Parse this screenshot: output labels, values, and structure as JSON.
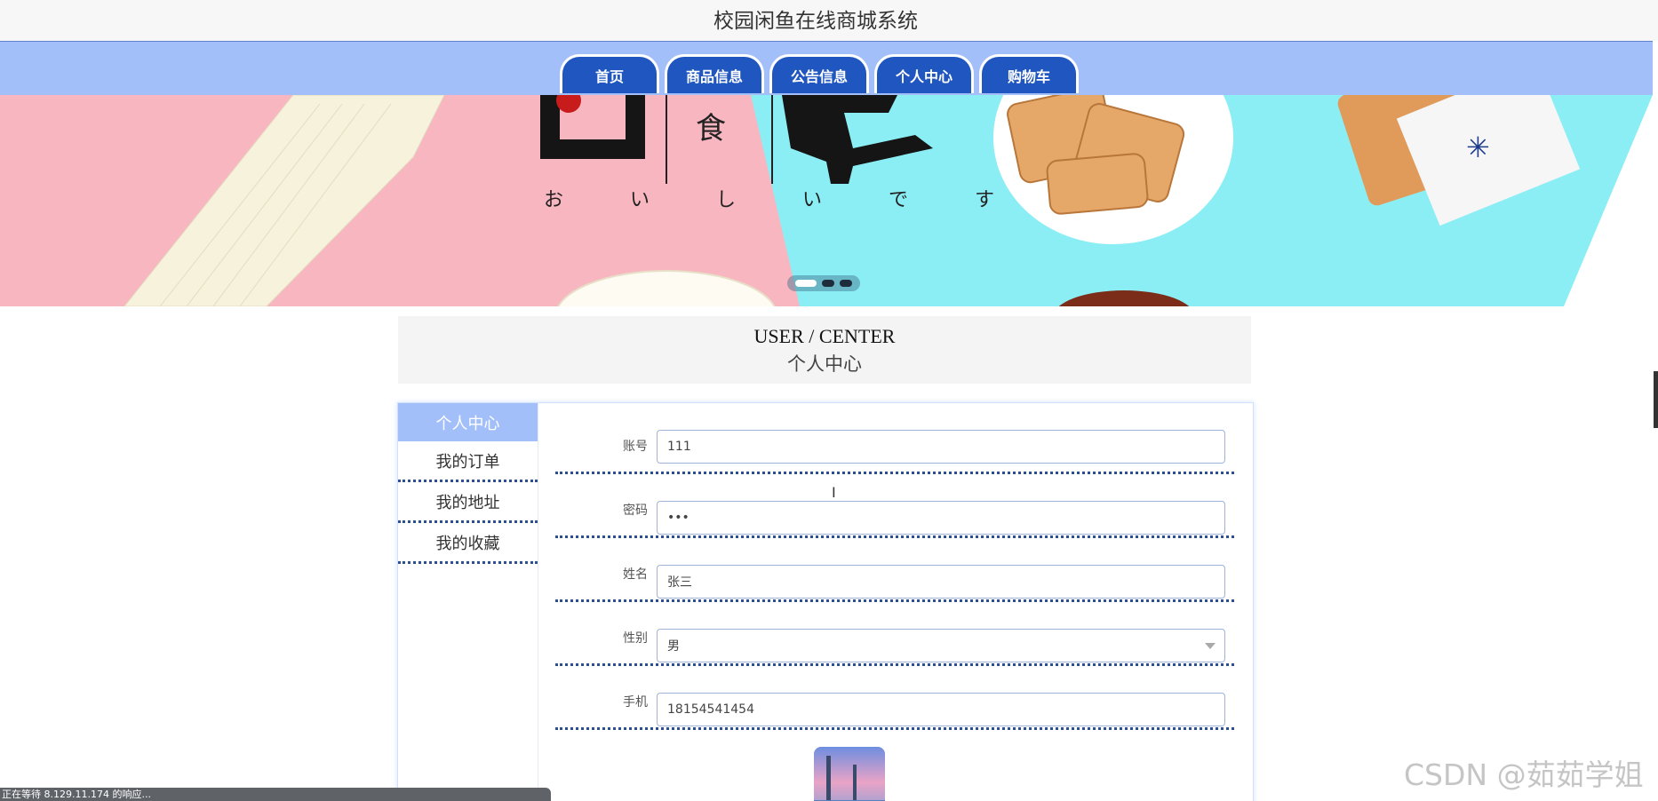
{
  "site": {
    "title": "校园闲鱼在线商城系统"
  },
  "nav": {
    "items": [
      {
        "label": "首页"
      },
      {
        "label": "商品信息"
      },
      {
        "label": "公告信息"
      },
      {
        "label": "个人中心"
      },
      {
        "label": "购物车"
      }
    ]
  },
  "banner": {
    "text_food": "食",
    "text_hiragana": "お い し い で す",
    "slide_count": 3,
    "active_slide": 1
  },
  "section": {
    "title_en": "USER / CENTER",
    "title_cn": "个人中心"
  },
  "side_menu": {
    "items": [
      {
        "label": "个人中心",
        "active": true
      },
      {
        "label": "我的订单",
        "active": false
      },
      {
        "label": "我的地址",
        "active": false
      },
      {
        "label": "我的收藏",
        "active": false
      }
    ]
  },
  "form": {
    "account_label": "账号",
    "account_value": "111",
    "password_label": "密码",
    "password_value": "•••",
    "name_label": "姓名",
    "name_value": "张三",
    "gender_label": "性别",
    "gender_value": "男",
    "phone_label": "手机",
    "phone_value": "18154541454"
  },
  "status_bar": {
    "text": "正在等待 8.129.11.174 的响应..."
  },
  "watermark": {
    "text": "CSDN @茹茹学姐"
  },
  "colors": {
    "nav_bar": "#a3bffa",
    "nav_tab": "#2056c0",
    "active_menu": "#a3bffa",
    "dotted_divider": "#2c4f8f"
  }
}
